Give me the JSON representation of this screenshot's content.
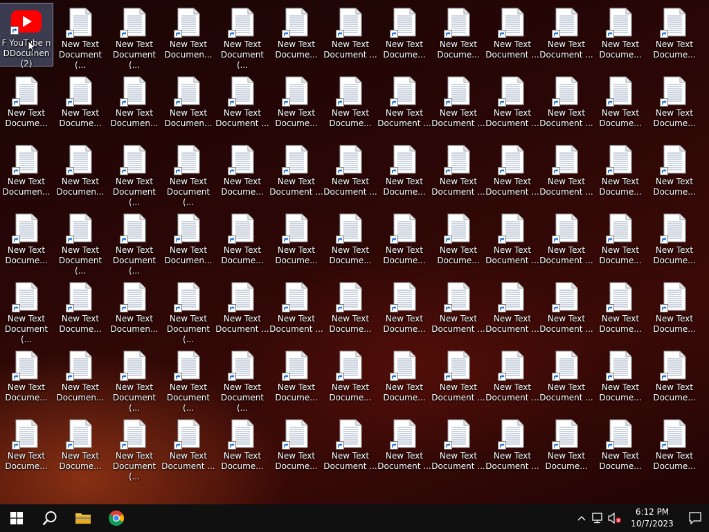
{
  "desktop": {
    "first_icon": {
      "name": "YouTube shortcut",
      "label_line1": "F YouTube n",
      "label_line2": "DDocumen (2)",
      "icon": "youtube-icon"
    },
    "rows": [
      [
        "",
        "New Text\nDocument (...",
        "New Text\nDocument (...",
        "New Text\nDocumen...",
        "New Text\nDocument (...",
        "New Text\nDocume...",
        "New Text\nDocument ...",
        "New Text\nDocume...",
        "New Text\nDocume...",
        "New Text\nDocument ...",
        "New Text\nDocument ...",
        "New Text\nDocume...",
        "New Text\nDocume..."
      ],
      [
        "New Text\nDocume...",
        "New Text\nDocume...",
        "New Text\nDocumen...",
        "New Text\nDocumen...",
        "New Text\nDocument ...",
        "New Text\nDocume...",
        "New Text\nDocume...",
        "New Text\nDocument ...",
        "New Text\nDocument ...",
        "New Text\nDocument ...",
        "New Text\nDocument ...",
        "New Text\nDocume...",
        "New Text\nDocume..."
      ],
      [
        "New Text\nDocumen...",
        "New Text\nDocumen...",
        "New Text\nDocument (...",
        "New Text\nDocument (...",
        "New Text\nDocume...",
        "New Text\nDocument ...",
        "New Text\nDocument ...",
        "New Text\nDocume...",
        "New Text\nDocument ...",
        "New Text\nDocument ...",
        "New Text\nDocument ...",
        "New Text\nDocume...",
        "New Text\nDocume..."
      ],
      [
        "New Text\nDocume...",
        "New Text\nDocument (...",
        "New Text\nDocument (...",
        "New Text\nDocumen...",
        "New Text\nDocume...",
        "New Text\nDocume...",
        "New Text\nDocume...",
        "New Text\nDocume...",
        "New Text\nDocume...",
        "New Text\nDocument ...",
        "New Text\nDocument ...",
        "New Text\nDocume...",
        "New Text\nDocume..."
      ],
      [
        "New Text\nDocument (...",
        "New Text\nDocume...",
        "New Text\nDocumen...",
        "New Text\nDocument (...",
        "New Text\nDocument ...",
        "New Text\nDocument ...",
        "New Text\nDocume...",
        "New Text\nDocume...",
        "New Text\nDocument ...",
        "New Text\nDocument ...",
        "New Text\nDocument ...",
        "New Text\nDocume...",
        "New Text\nDocume..."
      ],
      [
        "New Text\nDocume...",
        "New Text\nDocumen...",
        "New Text\nDocument (...",
        "New Text\nDocument (...",
        "New Text\nDocument (...",
        "New Text\nDocume...",
        "New Text\nDocume...",
        "New Text\nDocume...",
        "New Text\nDocument ...",
        "New Text\nDocument ...",
        "New Text\nDocument ...",
        "New Text\nDocume...",
        "New Text\nDocume..."
      ],
      [
        "New Text\nDocume...",
        "New Text\nDocume...",
        "New Text\nDocument (...",
        "New Text\nDocument ...",
        "New Text\nDocume...",
        "New Text\nDocume...",
        "New Text\nDocument ...",
        "New Text\nDocument ...",
        "New Text\nDocument ...",
        "New Text\nDocument ...",
        "New Text\nDocume...",
        "New Text\nDocume...",
        "New Text\nDocume..."
      ]
    ]
  },
  "taskbar": {
    "start_icon": "windows-start-icon",
    "search_icon": "search-icon",
    "pinned": [
      {
        "name": "file-explorer",
        "icon": "folder-icon"
      },
      {
        "name": "chrome",
        "icon": "chrome-icon"
      }
    ],
    "tray": {
      "time": "6:12 PM",
      "date": "10/7/2023"
    }
  },
  "colors": {
    "taskbar_bg": "#101010",
    "youtube_red": "#ff0000",
    "selection": "#78a0dc"
  }
}
